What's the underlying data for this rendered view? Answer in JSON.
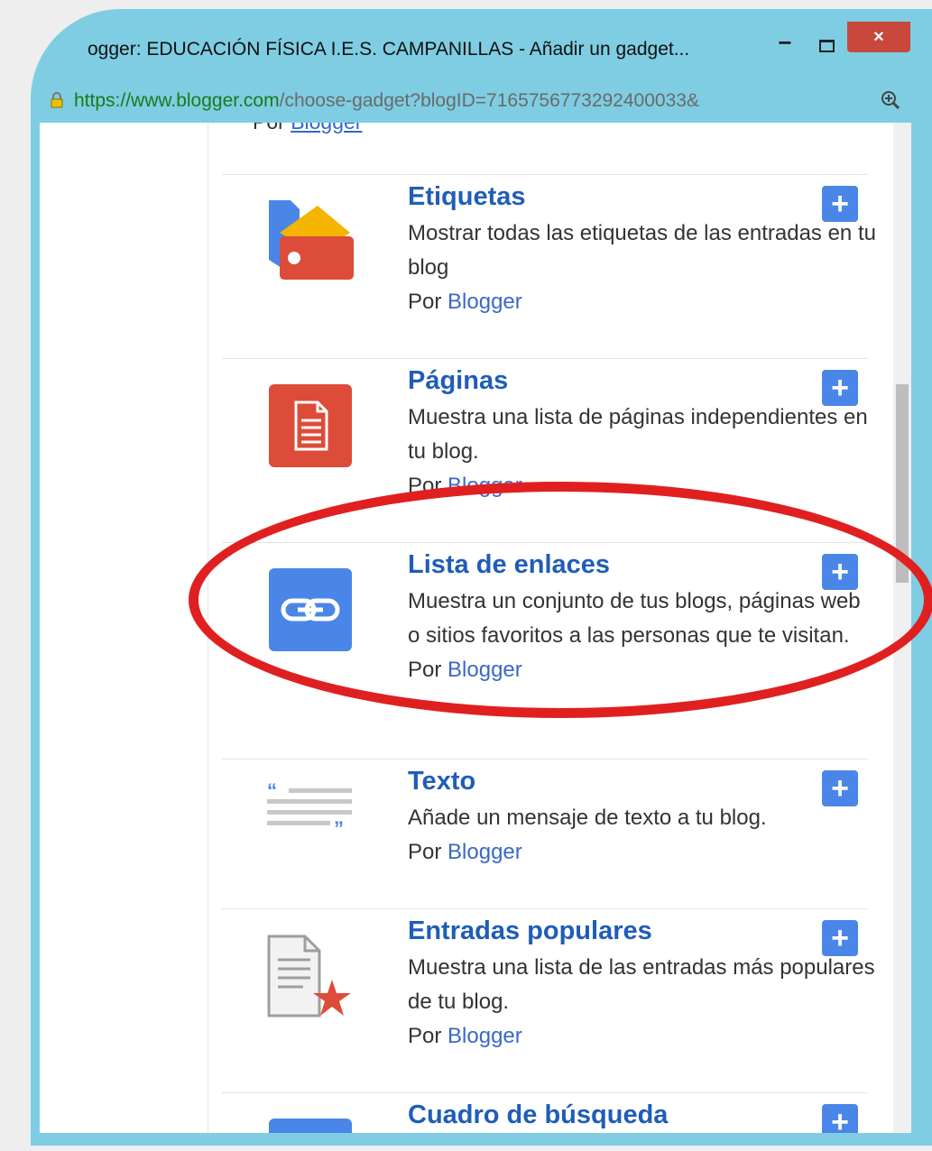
{
  "window": {
    "title": "ogger: EDUCACIÓN FÍSICA I.E.S. CAMPANILLAS - Añadir un gadget...",
    "minimize": "−",
    "close": "×"
  },
  "address": {
    "url_secure": "https://",
    "url_host": "www.blogger.com",
    "url_rest": "/choose-gadget?blogID=7165756773292400033&"
  },
  "partial_top": {
    "prefix": "Por ",
    "link": "Blogger"
  },
  "gadgets": [
    {
      "title": "Etiquetas",
      "description": "Mostrar todas las etiquetas de las entradas en tu blog",
      "by_prefix": "Por",
      "by_link": "Blogger",
      "add": "+",
      "icon": "labels-icon"
    },
    {
      "title": "Páginas",
      "description": "Muestra una lista de páginas independientes en tu blog.",
      "by_prefix": "Por",
      "by_link": "Blogger",
      "add": "+",
      "icon": "pages-icon"
    },
    {
      "title": "Lista de enlaces",
      "description": "Muestra un conjunto de tus blogs, páginas web o sitios favoritos a las personas que te visitan.",
      "by_prefix": "Por",
      "by_link": "Blogger",
      "add": "+",
      "icon": "link-icon"
    },
    {
      "title": "Texto",
      "description": "Añade un mensaje de texto a tu blog.",
      "by_prefix": "Por",
      "by_link": "Blogger",
      "add": "+",
      "icon": "text-icon"
    },
    {
      "title": "Entradas populares",
      "description": "Muestra una lista de las entradas más populares de tu blog.",
      "by_prefix": "Por",
      "by_link": "Blogger",
      "add": "+",
      "icon": "popular-posts-icon"
    },
    {
      "title": "Cuadro de búsqueda",
      "description": "",
      "by_prefix": "",
      "by_link": "",
      "add": "+",
      "icon": "search-box-icon"
    }
  ],
  "colors": {
    "title_blue": "#1f5db8",
    "add_button": "#4a86e8",
    "highlight_circle": "#e02020",
    "window_frame": "#7ecde3"
  }
}
